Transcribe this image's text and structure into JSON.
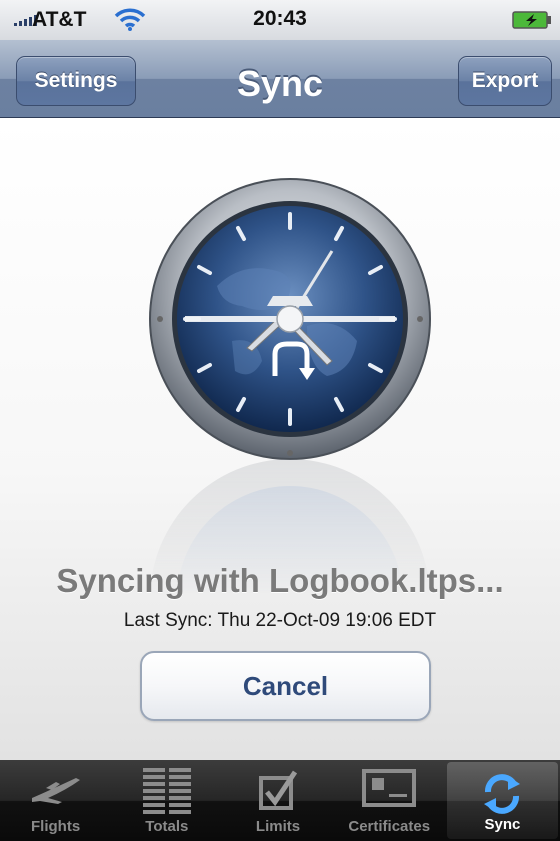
{
  "status_bar": {
    "carrier": "AT&T",
    "time": "20:43",
    "icons": [
      "signal-icon",
      "wifi-icon",
      "battery-charging-icon"
    ]
  },
  "nav_bar": {
    "title": "Sync",
    "left_button": "Settings",
    "right_button": "Export"
  },
  "main": {
    "status_text": "Syncing with Logbook.ltps...",
    "last_sync": "Last Sync: Thu 22-Oct-09 19:06 EDT",
    "cancel_label": "Cancel",
    "graphic": "clock-globe-icon"
  },
  "tab_bar": {
    "active": "Sync",
    "tabs": [
      {
        "label": "Flights",
        "icon": "airplane-icon"
      },
      {
        "label": "Totals",
        "icon": "totals-icon"
      },
      {
        "label": "Limits",
        "icon": "checkbox-icon"
      },
      {
        "label": "Certificates",
        "icon": "certificate-icon"
      },
      {
        "label": "Sync",
        "icon": "sync-icon"
      }
    ]
  },
  "colors": {
    "nav_bar": "#7f93b3",
    "cancel_text": "#2f4a7a",
    "status_text": "#7a7a7a",
    "sync_active": "#4aa8ff"
  }
}
